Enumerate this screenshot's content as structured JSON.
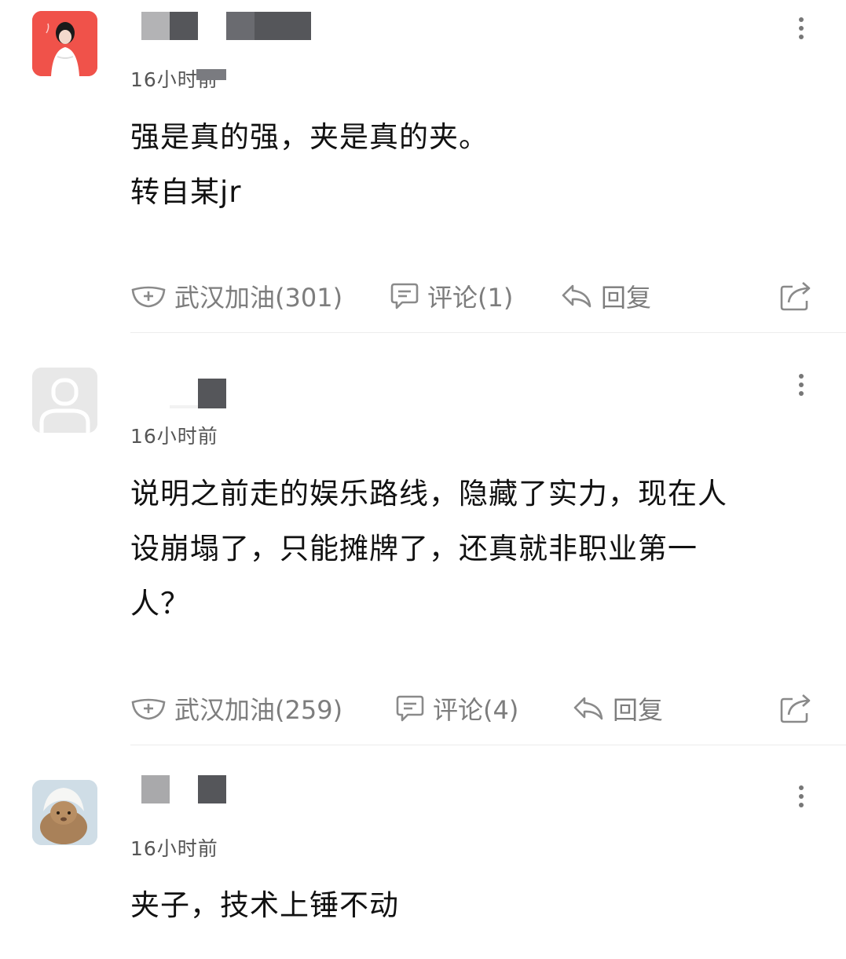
{
  "comments": [
    {
      "time": "16小时前",
      "text": "强是真的强，夹是真的夹。\n转自某jr",
      "actions": {
        "support": "武汉加油(301)",
        "comment": "评论(1)",
        "reply": "回复"
      }
    },
    {
      "time": "16小时前",
      "text": "说明之前走的娱乐路线，隐藏了实力，现在人\n设崩塌了，只能摊牌了，还真就非职业第一\n人？",
      "actions": {
        "support": "武汉加油(259)",
        "comment": "评论(4)",
        "reply": "回复"
      }
    },
    {
      "time": "16小时前",
      "text": "夹子，技术上锤不动"
    }
  ],
  "icons": {
    "support": "mask-plus-icon",
    "comment": "speech-bubble-icon",
    "reply": "reply-arrow-icon",
    "share": "share-icon",
    "more": "more-vertical-icon",
    "default_avatar": "user-silhouette-icon"
  },
  "colors": {
    "text": "#111111",
    "meta": "#555555",
    "action": "#7d7d7d",
    "divider": "#ececec",
    "avatar_red": "#f0524a"
  }
}
